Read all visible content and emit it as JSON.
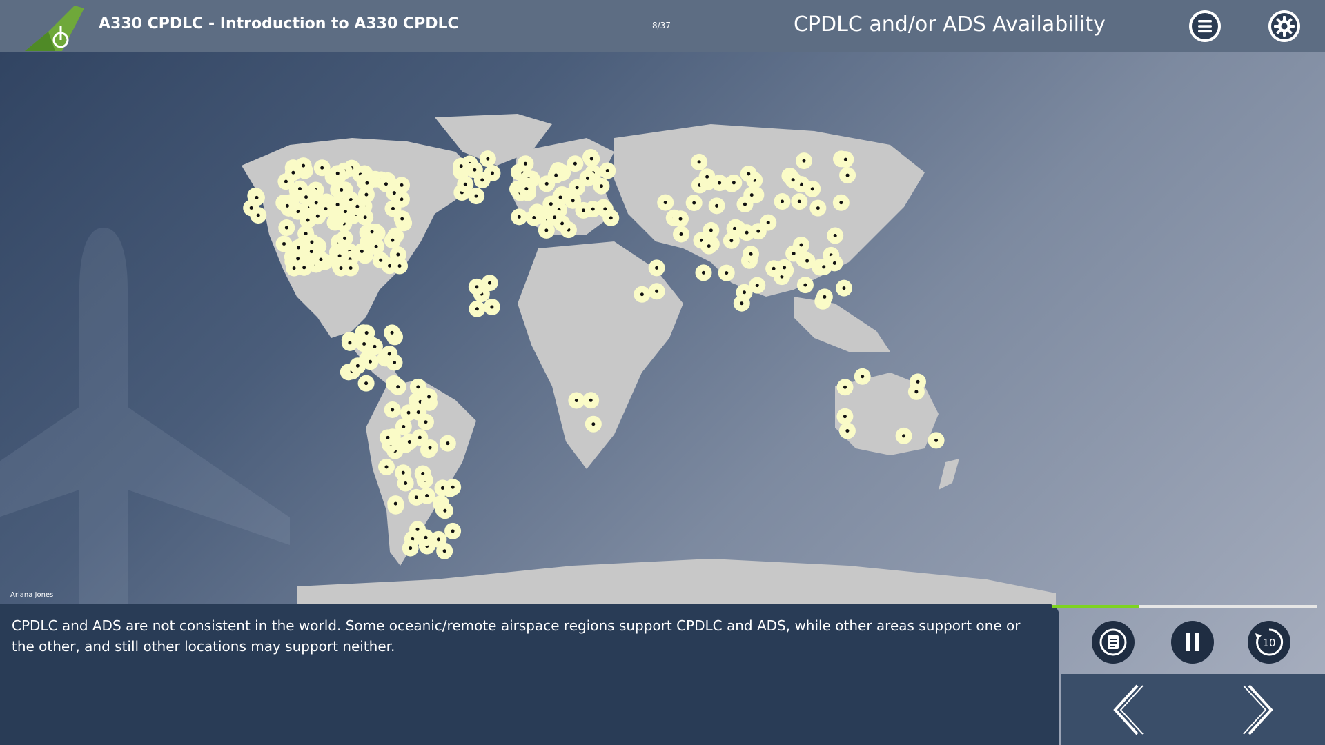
{
  "header": {
    "course_title": "A330 CPDLC - Introduction to A330 CPDLC",
    "page_counter": "8/37",
    "slide_title": "CPDLC and/or ADS Availability",
    "menu_icon": "menu-icon",
    "settings_icon": "gear-icon"
  },
  "presenter": "Ariana Jones",
  "caption": {
    "text": "CPDLC and ADS are not consistent in the world. Some oceanic/remote airspace regions support CPDLC and ADS, while other areas support one or the other, and still other locations may support neither."
  },
  "player": {
    "progress": 0.33,
    "progress_color": "#7ed321",
    "transcript_icon": "transcript-icon",
    "pause_icon": "pause-icon",
    "replay_icon": "replay-10-icon",
    "replay_label": "10",
    "prev_icon": "chevron-left-icon",
    "next_icon": "chevron-right-icon"
  },
  "colors": {
    "header_bg": "#5d6d83",
    "caption_bg": "#293c56",
    "land": "#c8c8c8",
    "marker": "#fafbc7",
    "accent_logo": "#6fa83a"
  }
}
